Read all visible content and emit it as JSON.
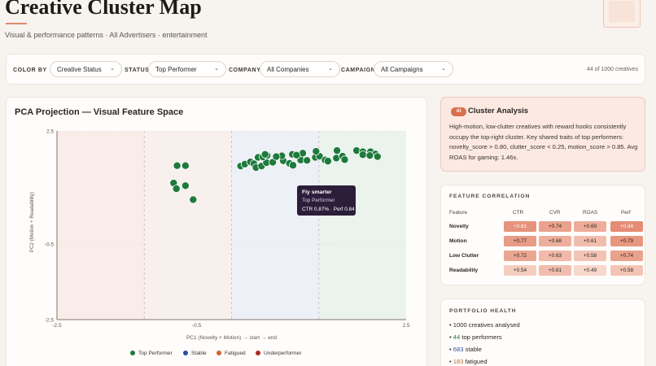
{
  "header": {
    "title": "Creative Cluster Map",
    "subtitle": "Visual & performance patterns · All Advertisers · entertainment"
  },
  "filters": {
    "color_by": {
      "label": "COLOR BY",
      "value": "Creative Status"
    },
    "status": {
      "label": "STATUS",
      "value": "Top Performer"
    },
    "company": {
      "label": "COMPANY",
      "value": "All Companies"
    },
    "campaign": {
      "label": "CAMPAIGN",
      "value": "All Campaigns"
    },
    "count_text": "44 of 1000 creatives"
  },
  "chart_card": {
    "title": "PCA Projection — Visual Feature Space"
  },
  "chart_data": {
    "type": "scatter",
    "title": "PCA Projection — Visual Feature Space",
    "xlabel": "PC1 (Novelty + Motion) → start → end",
    "ylabel": "PC2 (Motion + Readability)",
    "xlim": [
      -2.5,
      2.5
    ],
    "ylim": [
      -2.5,
      2.5
    ],
    "x_ticks": [
      "-2.5",
      "-0.5",
      "2.5"
    ],
    "y_ticks": [
      "2.5",
      "-0.5",
      "-2.5"
    ],
    "grid": true,
    "legend_position": "bottom",
    "series": [
      {
        "name": "Top Performer",
        "color": "#1e7a3c",
        "points": [
          [
            -0.78,
            1.58
          ],
          [
            -0.66,
            1.58
          ],
          [
            -0.83,
            1.12
          ],
          [
            -0.66,
            1.05
          ],
          [
            -0.79,
            0.97
          ],
          [
            -0.55,
            0.68
          ],
          [
            0.13,
            1.57
          ],
          [
            0.19,
            1.62
          ],
          [
            0.27,
            1.68
          ],
          [
            0.32,
            1.63
          ],
          [
            0.35,
            1.53
          ],
          [
            0.43,
            1.57
          ],
          [
            0.5,
            1.66
          ],
          [
            0.59,
            1.67
          ],
          [
            0.74,
            1.71
          ],
          [
            0.83,
            1.64
          ],
          [
            0.88,
            1.59
          ],
          [
            0.99,
            1.73
          ],
          [
            1.08,
            1.72
          ],
          [
            1.2,
            1.8
          ],
          [
            1.26,
            1.83
          ],
          [
            1.34,
            1.73
          ],
          [
            1.38,
            1.7
          ],
          [
            1.5,
            1.78
          ],
          [
            1.59,
            1.83
          ],
          [
            1.62,
            1.74
          ],
          [
            1.79,
            1.98
          ],
          [
            1.88,
            1.95
          ],
          [
            1.99,
            1.95
          ],
          [
            2.06,
            1.89
          ],
          [
            1.88,
            1.87
          ],
          [
            1.98,
            1.85
          ],
          [
            2.09,
            1.82
          ],
          [
            1.51,
            1.98
          ],
          [
            1.21,
            1.96
          ],
          [
            1.02,
            1.91
          ],
          [
            0.87,
            1.88
          ],
          [
            0.93,
            1.86
          ],
          [
            0.72,
            1.84
          ],
          [
            0.64,
            1.82
          ],
          [
            0.38,
            1.8
          ],
          [
            0.45,
            1.81
          ],
          [
            0.51,
            1.85
          ],
          [
            0.48,
            1.88
          ]
        ]
      },
      {
        "name": "Stable",
        "color": "#2a4fa8",
        "points": []
      },
      {
        "name": "Fatigued",
        "color": "#d0652f",
        "points": []
      },
      {
        "name": "Underperformer",
        "color": "#b32626",
        "points": []
      }
    ],
    "tooltip": {
      "title": "Fly smarter",
      "status": "Top Performer",
      "metrics": "CTR 0.87% · Perf 0.84"
    }
  },
  "analysis": {
    "badge": "AI",
    "title": "Cluster Analysis",
    "body": "High-motion, low-clutter creatives with reward hooks consistently occupy the top-right cluster. Key shared traits of top performers: novelty_score > 0.80, clutter_score < 0.25, motion_score > 0.85. Avg ROAS for gaming: 1.46x."
  },
  "feature_correlation": {
    "label": "FEATURE CORRELATION",
    "columns": [
      "Feature",
      "CTR",
      "CVR",
      "ROAS",
      "Perf"
    ],
    "rows": [
      {
        "feature": "Novelty",
        "values": [
          "+0.81",
          "+0.74",
          "+0.69",
          "+0.84"
        ]
      },
      {
        "feature": "Motion",
        "values": [
          "+0.77",
          "+0.68",
          "+0.61",
          "+0.79"
        ]
      },
      {
        "feature": "Low Clutter",
        "values": [
          "+0.72",
          "+0.63",
          "+0.58",
          "+0.74"
        ]
      },
      {
        "feature": "Readability",
        "values": [
          "+0.54",
          "+0.61",
          "+0.49",
          "+0.58"
        ]
      }
    ]
  },
  "portfolio_health": {
    "label": "PORTFOLIO HEALTH",
    "items": [
      {
        "prefix": "• ",
        "num": "1000",
        "text": " creatives analysed",
        "tone": "plain"
      },
      {
        "prefix": "• ",
        "num": "44",
        "text": " top performers",
        "tone": "green"
      },
      {
        "prefix": "• ",
        "num": "683",
        "text": " stable",
        "tone": "blue"
      },
      {
        "prefix": "• ",
        "num": "183",
        "text": " fatigued",
        "tone": "orange"
      }
    ]
  }
}
